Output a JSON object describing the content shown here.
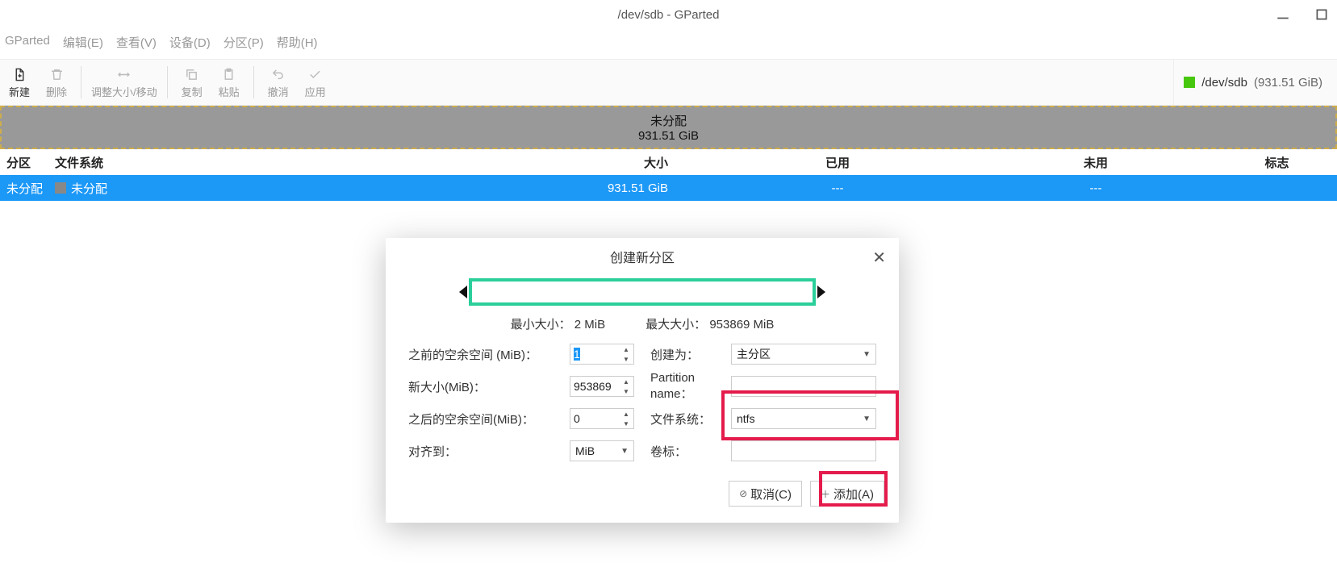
{
  "window": {
    "title": "/dev/sdb - GParted"
  },
  "menu": {
    "gparted": "GParted",
    "edit": "编辑(E)",
    "view": "查看(V)",
    "device": "设备(D)",
    "partition": "分区(P)",
    "help": "帮助(H)"
  },
  "toolbar": {
    "new": "新建",
    "delete": "删除",
    "resize": "调整大小/移动",
    "copy": "复制",
    "paste": "粘贴",
    "undo": "撤消",
    "apply": "应用"
  },
  "device_selector": {
    "label": "/dev/sdb",
    "size": "(931.51 GiB)"
  },
  "partition_bar": {
    "label": "未分配",
    "size": "931.51 GiB"
  },
  "columns": {
    "partition": "分区",
    "filesystem": "文件系统",
    "size": "大小",
    "used": "已用",
    "free": "未用",
    "flags": "标志"
  },
  "rows": [
    {
      "partition": "未分配",
      "filesystem": "未分配",
      "size": "931.51 GiB",
      "used": "---",
      "free": "---",
      "flags": ""
    }
  ],
  "dialog": {
    "title": "创建新分区",
    "min_label": "最小大小：",
    "min_value": "2 MiB",
    "max_label": "最大大小：",
    "max_value": "953869 MiB",
    "free_before_label": "之前的空余空间 (MiB)：",
    "free_before_value": "1",
    "new_size_label": "新大小(MiB)：",
    "new_size_value": "953869",
    "free_after_label": "之后的空余空间(MiB)：",
    "free_after_value": "0",
    "align_label": "对齐到：",
    "align_value": "MiB",
    "create_as_label": "创建为：",
    "create_as_value": "主分区",
    "pname_label": "Partition name：",
    "pname_value": "",
    "fs_label": "文件系统：",
    "fs_value": "ntfs",
    "vol_label": "卷标：",
    "vol_value": "",
    "cancel": "取消(C)",
    "add": "添加(A)"
  }
}
